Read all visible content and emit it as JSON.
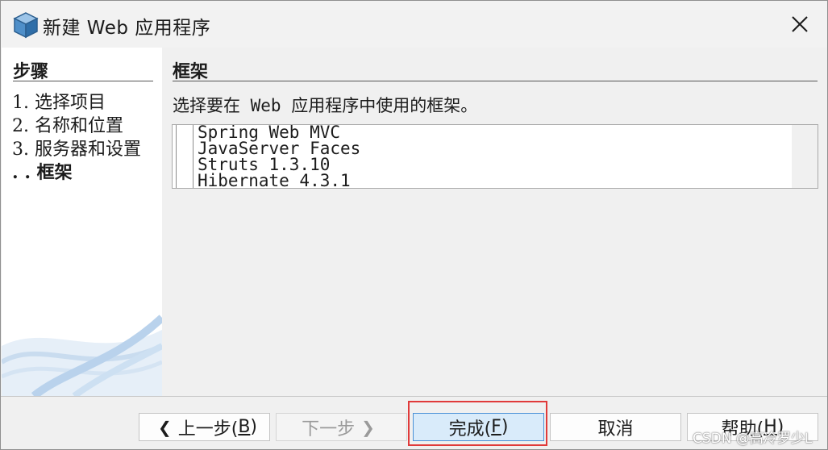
{
  "window": {
    "title": "新建 Web 应用程序",
    "app_icon": "cube-icon",
    "close_icon": "close-icon"
  },
  "steps": {
    "heading": "步骤",
    "items": [
      {
        "label": "1. 选择项目",
        "current": false
      },
      {
        "label": "2. 名称和位置",
        "current": false
      },
      {
        "label": "3. 服务器和设置",
        "current": false
      },
      {
        "label": ". . 框架",
        "current": true
      }
    ]
  },
  "content": {
    "heading": "框架",
    "instruction": "选择要在 Web 应用程序中使用的框架。",
    "frameworks": [
      {
        "name": "Spring Web MVC",
        "checked": false
      },
      {
        "name": "JavaServer Faces",
        "checked": false
      },
      {
        "name": "Struts 1.3.10",
        "checked": false
      },
      {
        "name": "Hibernate 4.3.1",
        "checked": false
      }
    ]
  },
  "buttons": {
    "back": {
      "prefix": "上一步(",
      "mnemonic": "B",
      "suffix": ")",
      "icon": "chevron-left-icon"
    },
    "next": {
      "label": "下一步",
      "icon": "chevron-right-icon",
      "enabled": false
    },
    "finish": {
      "prefix": "完成(",
      "mnemonic": "F",
      "suffix": ")"
    },
    "cancel": {
      "label": "取消"
    },
    "help": {
      "prefix": "帮助(",
      "mnemonic": "H",
      "suffix": ")"
    }
  },
  "watermark": "CSDN @高冷罗少L",
  "colors": {
    "window_bg": "#f0f0f0",
    "panel_bg": "#ffffff",
    "primary_button_bg": "#d9ebfa",
    "primary_button_border": "#4a90d6",
    "highlight_box": "#e03a3a"
  }
}
